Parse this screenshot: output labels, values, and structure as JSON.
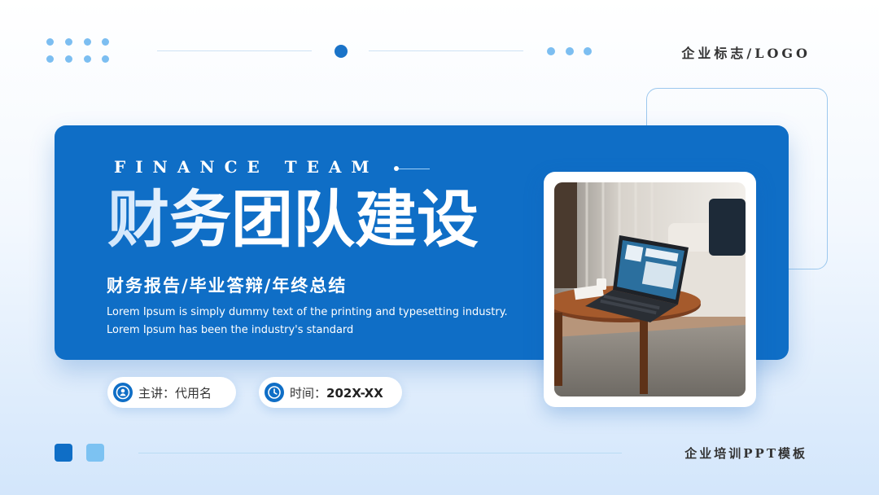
{
  "header": {
    "logo_text": "企业标志/LOGO"
  },
  "banner": {
    "kicker": "FINANCE TEAM",
    "title": "财务团队建设",
    "subtitle": "财务报告/毕业答辩/年终总结",
    "description_line1": "Lorem Ipsum is simply dummy text of the printing and typesetting industry.",
    "description_line2": "Lorem Ipsum has been the industry's standard"
  },
  "info": {
    "presenter_label": "主讲：",
    "presenter_value": "代用名",
    "time_label": "时间：",
    "time_value": "202X-XX"
  },
  "footer": {
    "text": "企业培训PPT模板"
  },
  "icons": {
    "presenter": "user-icon",
    "time": "clock-icon"
  },
  "colors": {
    "primary": "#0f6ec6",
    "accent_light": "#7cc2f2",
    "dot": "#7cbef1"
  }
}
